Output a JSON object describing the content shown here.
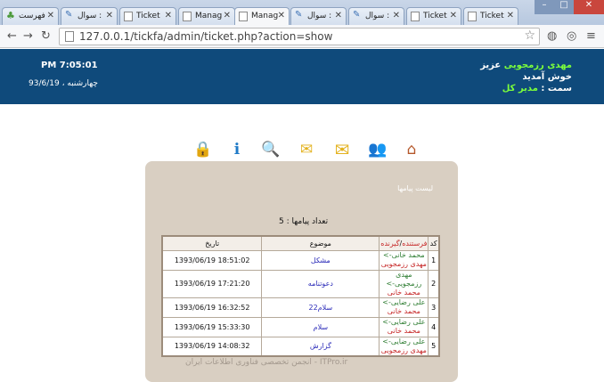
{
  "browser": {
    "tabs": [
      {
        "label": "فهرست",
        "icon": "tree-icon"
      },
      {
        "label": "سوال :",
        "icon": "feather-icon"
      },
      {
        "label": "Ticket",
        "icon": "page-icon"
      },
      {
        "label": "Manag",
        "icon": "page-icon"
      },
      {
        "label": "Manag",
        "icon": "page-icon",
        "active": true
      },
      {
        "label": "سوال :",
        "icon": "feather-icon"
      },
      {
        "label": "سوال :",
        "icon": "feather-icon"
      },
      {
        "label": "Ticket",
        "icon": "page-icon"
      },
      {
        "label": "Ticket",
        "icon": "page-icon"
      }
    ],
    "url": "127.0.0.1/tickfa/admin/ticket.php?action=show"
  },
  "header": {
    "time": "PM 7:05:01",
    "date": "چهارشنبه ، 93/6/19",
    "user_name": "مهدی رزمجویی",
    "greeting_suffix": "عزیز",
    "welcome": "خوش آمدید",
    "role_label": "سمت :",
    "role_value": "مدیر کل"
  },
  "toolbar_icons": [
    "home-icon",
    "users-icon",
    "inbox-icon",
    "new-message-icon",
    "search-icon",
    "info-icon",
    "lock-icon"
  ],
  "panel": {
    "title": "لیست پیامها",
    "count_text": "تعداد پیامها : 5",
    "columns": {
      "code": "کد",
      "sender": "فرستنده",
      "slash": "/",
      "receiver": "گیرنده",
      "subject": "موضوع",
      "date": "تاریخ"
    },
    "rows": [
      {
        "code": "1",
        "from": "محمد خانی->",
        "to": "مهدی رزمجویی",
        "subject": "مشکل",
        "date": "1393/06/19 18:51:02"
      },
      {
        "code": "2",
        "from": "مهدی رزمجویی->",
        "to": "محمد خانی",
        "subject": "دعوتنامه",
        "date": "1393/06/19 17:21:20"
      },
      {
        "code": "3",
        "from": "علی رضایی->",
        "to": "محمد خانی",
        "subject": "سلام22",
        "date": "1393/06/19 16:32:52"
      },
      {
        "code": "4",
        "from": "علی رضایی->",
        "to": "محمد خانی",
        "subject": "سلام",
        "date": "1393/06/19 15:33:30"
      },
      {
        "code": "5",
        "from": "علی رضایی->",
        "to": "مهدی رزمجویی",
        "subject": "گزارش",
        "date": "1393/06/19 14:08:32"
      }
    ]
  },
  "watermark": "ITPro.ir - انجمن تخصصی فناوری اطلاعات ایران"
}
